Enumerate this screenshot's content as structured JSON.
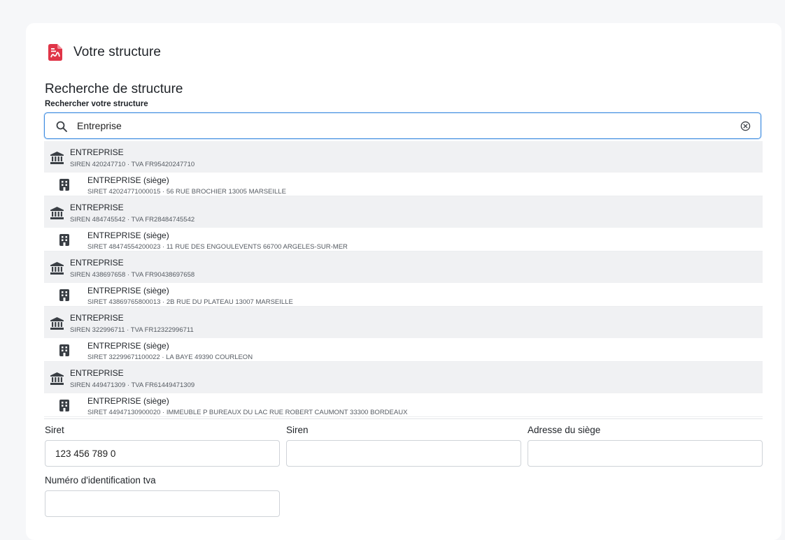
{
  "header": {
    "title": "Votre structure",
    "icon": "pdf-document-icon",
    "accent": "#e03548"
  },
  "search": {
    "section_title": "Recherche de structure",
    "label": "Rechercher votre structure",
    "value": "Entreprise",
    "focus_color": "#3d8ce0"
  },
  "results": [
    {
      "parent": {
        "name": "ENTREPRISE",
        "meta": "SIREN 420247710 · TVA FR95420247710"
      },
      "child": {
        "name": "ENTREPRISE (siège)",
        "meta": "SIRET 42024771000015 · 56 RUE BROCHIER 13005 MARSEILLE"
      }
    },
    {
      "parent": {
        "name": "ENTREPRISE",
        "meta": "SIREN 484745542 · TVA FR28484745542"
      },
      "child": {
        "name": "ENTREPRISE (siège)",
        "meta": "SIRET 48474554200023 · 11 RUE DES ENGOULEVENTS 66700 ARGELES-SUR-MER"
      }
    },
    {
      "parent": {
        "name": "ENTREPRISE",
        "meta": "SIREN 438697658 · TVA FR90438697658"
      },
      "child": {
        "name": "ENTREPRISE (siège)",
        "meta": "SIRET 43869765800013 · 2B RUE DU PLATEAU 13007 MARSEILLE"
      }
    },
    {
      "parent": {
        "name": "ENTREPRISE",
        "meta": "SIREN 322996711 · TVA FR12322996711"
      },
      "child": {
        "name": "ENTREPRISE (siège)",
        "meta": "SIRET 32299671100022 · LA BAYE 49390 COURLEON"
      }
    },
    {
      "parent": {
        "name": "ENTREPRISE",
        "meta": "SIREN 449471309 · TVA FR61449471309"
      },
      "child": {
        "name": "ENTREPRISE (siège)",
        "meta": "SIRET 44947130900020 · IMMEUBLE P BUREAUX DU LAC RUE ROBERT CAUMONT 33300 BORDEAUX"
      }
    }
  ],
  "form": {
    "siret": {
      "label": "Siret",
      "value": "123 456 789 0"
    },
    "siren": {
      "label": "Siren",
      "value": ""
    },
    "address": {
      "label": "Adresse du siège",
      "value": ""
    },
    "tva": {
      "label": "Numéro d'identification tva",
      "value": ""
    }
  }
}
